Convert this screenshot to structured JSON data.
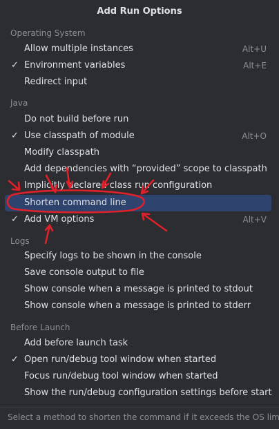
{
  "title": "Add Run Options",
  "sections": {
    "os": "Operating System",
    "java": "Java",
    "logs": "Logs",
    "before_launch": "Before Launch"
  },
  "items": [
    {
      "label": "Allow multiple instances",
      "shortcut": "Alt+U",
      "checked": false
    },
    {
      "label": "Environment variables",
      "shortcut": "Alt+E",
      "checked": true
    },
    {
      "label": "Redirect input",
      "shortcut": "",
      "checked": false
    },
    {
      "label": "Do not build before run",
      "shortcut": "",
      "checked": false
    },
    {
      "label": "Use classpath of module",
      "shortcut": "Alt+O",
      "checked": true
    },
    {
      "label": "Modify classpath",
      "shortcut": "",
      "checked": false
    },
    {
      "label": "Add dependencies with “provided” scope to classpath",
      "shortcut": "",
      "checked": false
    },
    {
      "label": "Implicitly declared class run configuration",
      "shortcut": "",
      "checked": false
    },
    {
      "label": "Shorten command line",
      "shortcut": "",
      "checked": false,
      "selected": true
    },
    {
      "label": "Add VM options",
      "shortcut": "Alt+V",
      "checked": true
    },
    {
      "label": "Specify logs to be shown in the console",
      "shortcut": "",
      "checked": false
    },
    {
      "label": "Save console output to file",
      "shortcut": "",
      "checked": false
    },
    {
      "label": "Show console when a message is printed to stdout",
      "shortcut": "",
      "checked": false
    },
    {
      "label": "Show console when a message is printed to stderr",
      "shortcut": "",
      "checked": false
    },
    {
      "label": "Add before launch task",
      "shortcut": "",
      "checked": false
    },
    {
      "label": "Open run/debug tool window when started",
      "shortcut": "",
      "checked": true
    },
    {
      "label": "Focus run/debug tool window when started",
      "shortcut": "",
      "checked": false
    },
    {
      "label": "Show the run/debug configuration settings before start",
      "shortcut": "",
      "checked": false
    }
  ],
  "check_glyph": "✓",
  "footer_hint": "Select a method to shorten the command if it exceeds the OS limit",
  "colors": {
    "background": "#2b2d30",
    "selection": "#2e436e",
    "annotation": "#e0202a"
  }
}
